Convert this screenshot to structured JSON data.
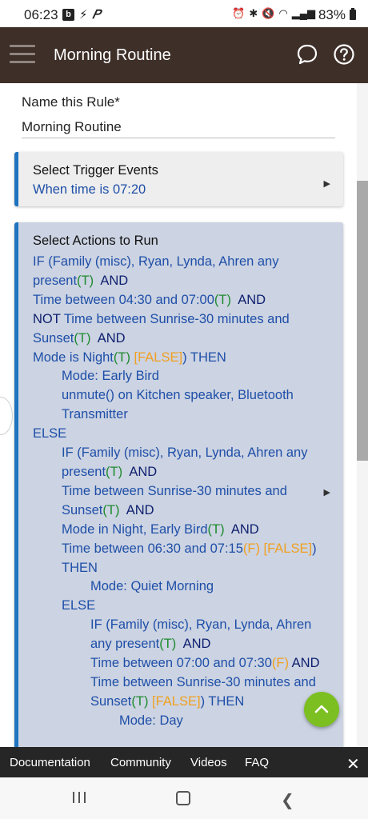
{
  "status_bar": {
    "time": "06:23",
    "notification_letter": "b",
    "battery": "83%"
  },
  "app_bar": {
    "title": "Morning Routine"
  },
  "rule_name": {
    "label": "Name this Rule*",
    "value": "Morning Routine"
  },
  "trigger_card": {
    "title": "Select Trigger Events",
    "value": "When time is 07:20"
  },
  "actions_card": {
    "title": "Select Actions to Run",
    "lines": [
      {
        "indent": 0,
        "parts": [
          {
            "c": "b",
            "t": "IF (Family (misc), Ryan, Lynda, Ahren any present"
          },
          {
            "c": "t",
            "t": "(T)"
          },
          {
            "c": "k",
            "t": "  AND"
          }
        ]
      },
      {
        "indent": 0,
        "parts": [
          {
            "c": "b",
            "t": "Time between 04:30 and 07:00"
          },
          {
            "c": "t",
            "t": "(T)"
          },
          {
            "c": "k",
            "t": "  AND"
          }
        ]
      },
      {
        "indent": 0,
        "parts": [
          {
            "c": "k",
            "t": "NOT "
          },
          {
            "c": "b",
            "t": "Time between Sunrise-30 minutes and Sunset"
          },
          {
            "c": "t",
            "t": "(T)"
          },
          {
            "c": "k",
            "t": "  AND"
          }
        ]
      },
      {
        "indent": 0,
        "parts": [
          {
            "c": "b",
            "t": "Mode is Night"
          },
          {
            "c": "t",
            "t": "(T)"
          },
          {
            "c": "f",
            "t": " [FALSE]"
          },
          {
            "c": "b",
            "t": ") THEN"
          }
        ]
      },
      {
        "indent": 1,
        "parts": [
          {
            "c": "b",
            "t": "Mode: Early Bird"
          }
        ]
      },
      {
        "indent": 1,
        "parts": [
          {
            "c": "b",
            "t": "unmute() on Kitchen speaker, Bluetooth Transmitter"
          }
        ]
      },
      {
        "indent": 0,
        "parts": [
          {
            "c": "b",
            "t": "ELSE"
          }
        ]
      },
      {
        "indent": 1,
        "parts": [
          {
            "c": "b",
            "t": "IF (Family (misc), Ryan, Lynda, Ahren any present"
          },
          {
            "c": "t",
            "t": "(T)"
          },
          {
            "c": "k",
            "t": "  AND"
          }
        ]
      },
      {
        "indent": 1,
        "parts": [
          {
            "c": "b",
            "t": "Time between Sunrise-30 minutes and Sunset"
          },
          {
            "c": "t",
            "t": "(T)"
          },
          {
            "c": "k",
            "t": "  AND"
          }
        ]
      },
      {
        "indent": 1,
        "parts": [
          {
            "c": "b",
            "t": "Mode in Night, Early Bird"
          },
          {
            "c": "t",
            "t": "(T)"
          },
          {
            "c": "k",
            "t": "  AND"
          }
        ]
      },
      {
        "indent": 1,
        "parts": [
          {
            "c": "b",
            "t": "Time between 06:30 and 07:15"
          },
          {
            "c": "f",
            "t": "(F)"
          },
          {
            "c": "f",
            "t": " [FALSE]"
          },
          {
            "c": "b",
            "t": ") THEN"
          }
        ]
      },
      {
        "indent": 2,
        "parts": [
          {
            "c": "b",
            "t": "Mode: Quiet Morning"
          }
        ]
      },
      {
        "indent": 1,
        "parts": [
          {
            "c": "b",
            "t": "ELSE"
          }
        ]
      },
      {
        "indent": 2,
        "parts": [
          {
            "c": "b",
            "t": "IF (Family (misc), Ryan, Lynda, Ahren any present"
          },
          {
            "c": "t",
            "t": "(T)"
          },
          {
            "c": "k",
            "t": "  AND"
          }
        ]
      },
      {
        "indent": 2,
        "parts": [
          {
            "c": "b",
            "t": "Time between 07:00 and 07:30"
          },
          {
            "c": "f",
            "t": "(F)"
          },
          {
            "c": "k",
            "t": " AND"
          }
        ]
      },
      {
        "indent": 2,
        "parts": [
          {
            "c": "b",
            "t": "Time between Sunrise-30 minutes and Sunset"
          },
          {
            "c": "t",
            "t": "(T)"
          },
          {
            "c": "f",
            "t": " [FALSE]"
          },
          {
            "c": "b",
            "t": ") THEN"
          }
        ]
      },
      {
        "indent": 3,
        "parts": [
          {
            "c": "b",
            "t": "Mode: Day"
          }
        ]
      }
    ]
  },
  "footer": {
    "links": [
      "Documentation",
      "Community",
      "Videos",
      "FAQ"
    ]
  },
  "colors": {
    "app_bar": "#3e3029",
    "accent_blue": "#1e73be",
    "true_green": "#1d8a2e",
    "false_orange": "#f0a020",
    "fab_green": "#7cbf21"
  },
  "icons": [
    "hamburger-menu-icon",
    "chat-bubble-icon",
    "help-circle-icon",
    "expand-arrow-icon",
    "chevron-up-icon",
    "close-icon",
    "recents-icon",
    "home-icon",
    "back-icon"
  ]
}
